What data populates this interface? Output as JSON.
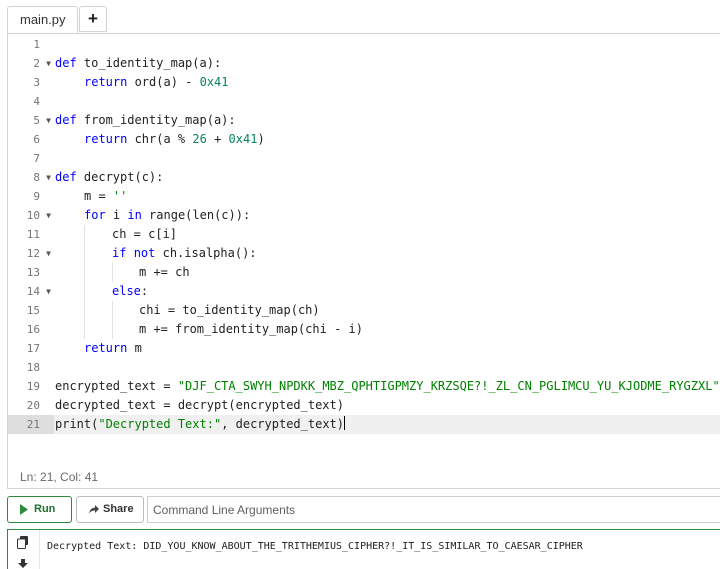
{
  "tabs": {
    "file": "main.py",
    "add": "+"
  },
  "editor": {
    "lines": [
      {
        "n": "1",
        "fold": ""
      },
      {
        "n": "2",
        "fold": "▼"
      },
      {
        "n": "3",
        "fold": ""
      },
      {
        "n": "4",
        "fold": ""
      },
      {
        "n": "5",
        "fold": "▼"
      },
      {
        "n": "6",
        "fold": ""
      },
      {
        "n": "7",
        "fold": ""
      },
      {
        "n": "8",
        "fold": "▼"
      },
      {
        "n": "9",
        "fold": ""
      },
      {
        "n": "10",
        "fold": "▼"
      },
      {
        "n": "11",
        "fold": ""
      },
      {
        "n": "12",
        "fold": "▼"
      },
      {
        "n": "13",
        "fold": ""
      },
      {
        "n": "14",
        "fold": "▼"
      },
      {
        "n": "15",
        "fold": ""
      },
      {
        "n": "16",
        "fold": ""
      },
      {
        "n": "17",
        "fold": ""
      },
      {
        "n": "18",
        "fold": ""
      },
      {
        "n": "19",
        "fold": ""
      },
      {
        "n": "20",
        "fold": ""
      },
      {
        "n": "21",
        "fold": ""
      }
    ],
    "tokens": {
      "def": "def",
      "return": "return",
      "for": "for",
      "in": "in",
      "if": "if",
      "not": "not",
      "else": "else",
      "fn1": " to_identity_map(a):",
      "l3a": " ord(a) - ",
      "hex41": "0x41",
      "fn2": " from_identity_map(a):",
      "l6a": " chr(a % ",
      "n26": "26",
      "plus": " + ",
      "close": ")",
      "fn3": " decrypt(c):",
      "l9": "m = ",
      "empty_str": "''",
      "l10b": " i ",
      "l10d": " range(len(c)):",
      "l11": "ch = c[i]",
      "l12b": " ch.isalpha():",
      "l13": "m += ch",
      "colon": ":",
      "l15": "chi = to_identity_map(ch)",
      "l16": "m += from_identity_map(chi - i)",
      "l17b": " m",
      "l19a": "encrypted_text = ",
      "cipher": "\"DJF_CTA_SWYH_NPDKK_MBZ_QPHTIGPMZY_KRZSQE?!_ZL_CN_PGLIMCU_YU_KJODME_RYGZXL\"",
      "l20": "decrypted_text = decrypt(encrypted_text)",
      "l21a": "print(",
      "label_str": "\"Decrypted Text:\"",
      "l21c": ", decrypted_text)"
    }
  },
  "status": {
    "text": "Ln: 21,  Col: 41"
  },
  "toolbar": {
    "run_label": "Run",
    "share_label": "Share",
    "args_placeholder": "Command Line Arguments"
  },
  "output": {
    "text": "Decrypted Text: DID_YOU_KNOW_ABOUT_THE_TRITHEMIUS_CIPHER?!_IT_IS_SIMILAR_TO_CAESAR_CIPHER"
  },
  "colors": {
    "keyword": "#0000ff",
    "number": "#098658",
    "string": "#008000",
    "run": "#2e8b3e"
  }
}
